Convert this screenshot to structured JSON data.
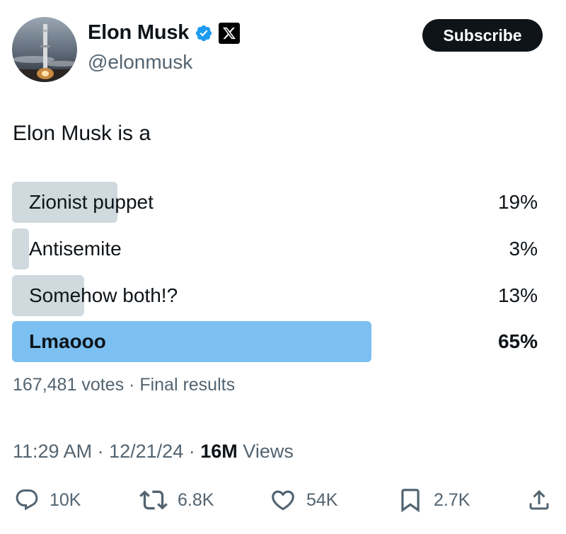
{
  "author": {
    "name": "Elon Musk",
    "handle": "@elonmusk",
    "verified_icon": "verified-badge-icon",
    "affiliation_icon": "x-logo-icon"
  },
  "subscribe_label": "Subscribe",
  "tweet_text": "Elon Musk is a",
  "poll": {
    "options": [
      {
        "label": "Zionist puppet",
        "percent_label": "19%",
        "percent": 19
      },
      {
        "label": "Antisemite",
        "percent_label": "3%",
        "percent": 3
      },
      {
        "label": "Somehow both!?",
        "percent_label": "13%",
        "percent": 13
      },
      {
        "label": "Lmaooo",
        "percent_label": "65%",
        "percent": 65
      }
    ],
    "votes": "167,481 votes",
    "separator": "·",
    "status": "Final results"
  },
  "timestamp": {
    "time": "11:29 AM",
    "date": "12/21/24",
    "views_count": "16M",
    "views_label": "Views"
  },
  "actions": {
    "replies": "10K",
    "reposts": "6.8K",
    "likes": "54K",
    "bookmarks": "2.7K"
  },
  "colors": {
    "bar": "#cfd9de",
    "winner_bar": "#7cc0f2",
    "verified": "#1d9bf0",
    "muted_text": "#536471"
  }
}
